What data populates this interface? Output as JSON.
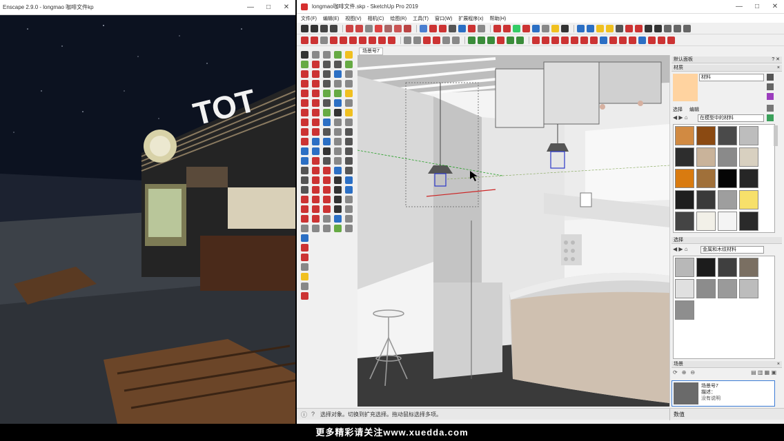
{
  "left_window": {
    "title": "Enscape 2.9.0 - longmao 咖啡文件kp",
    "controls": [
      "—",
      "□",
      "✕"
    ],
    "sign_text": "TOT"
  },
  "sketchup": {
    "title": "longmao咖啡文件.skp - SketchUp Pro 2019",
    "controls": [
      "—",
      "□",
      "✕"
    ],
    "menu": [
      "文件(F)",
      "编辑(E)",
      "视图(V)",
      "相机(C)",
      "绘图(R)",
      "工具(T)",
      "窗口(W)",
      "扩展程序(x)",
      "帮助(H)"
    ],
    "scene_tab": "场景号7",
    "status_text": "选择对象。切换到扩充选择。拖动鼠标选择多项。",
    "measurements_label": "数值"
  },
  "tray": {
    "title": "默认面板",
    "materials": {
      "header": "材质",
      "name_value": "材料",
      "tab_select": "选择",
      "tab_edit": "编辑",
      "library": "在模型中的材料",
      "colors": [
        "#d18a42",
        "#8b4a12",
        "#4a4a4a",
        "#bdbdbd",
        "#2d2d2d",
        "#c9b39a",
        "#8a8a8a",
        "#d8d0c0",
        "#d97b10",
        "#a0703a",
        "#050505",
        "#262626",
        "#1e1e1e",
        "#3a3a3a",
        "#9e9e9e",
        "#f7e06a",
        "#444444",
        "#f2f0e8",
        "#f4f4f4",
        "#2a2a2a"
      ],
      "current_color": "#ffd3a0"
    },
    "edit_section": {
      "header": "选择",
      "library": "金属和木纹材料",
      "colors": [
        "#b8b8b8",
        "#1c1c1c",
        "#3f3f3f",
        "#7a6f62",
        "#e0e0e0",
        "#8c8c8c",
        "#9a9a9a",
        "#bcbcbc",
        "#8e8e8e"
      ]
    },
    "scenes": {
      "header": "场景",
      "item_name": "场景号7",
      "item_desc_1": "描述：",
      "item_desc_2": "没有说明"
    }
  },
  "banner": {
    "text": "更多精彩请关注www.xuedda.com"
  }
}
